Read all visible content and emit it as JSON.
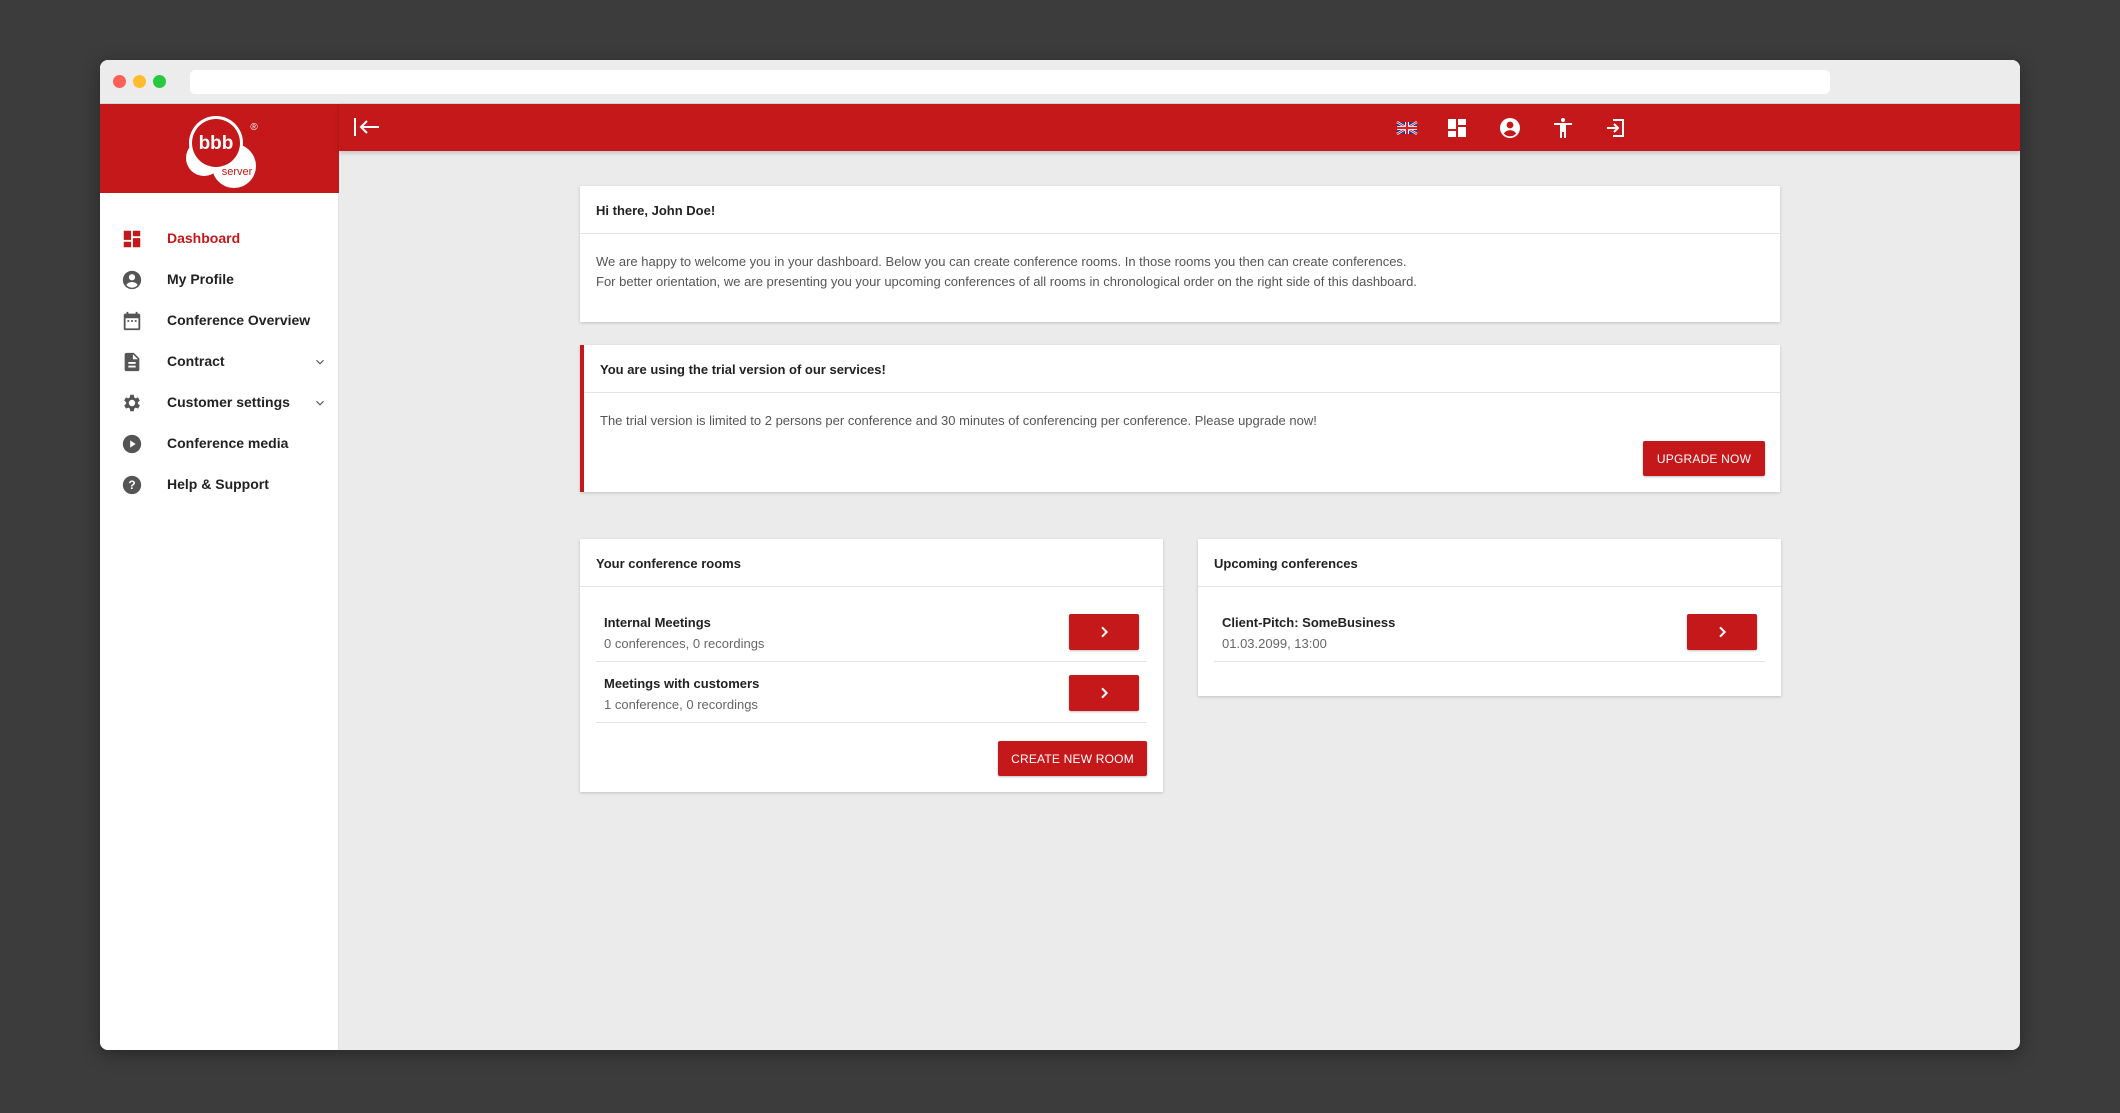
{
  "logo": {
    "text": "bbb",
    "subtext": "server",
    "registered": "®"
  },
  "sidebar": {
    "items": [
      {
        "label": "Dashboard",
        "icon": "dashboard-icon",
        "active": true
      },
      {
        "label": "My Profile",
        "icon": "account-circle-icon"
      },
      {
        "label": "Conference Overview",
        "icon": "calendar-icon"
      },
      {
        "label": "Contract",
        "icon": "document-icon",
        "expandable": true
      },
      {
        "label": "Customer settings",
        "icon": "gear-icon",
        "expandable": true
      },
      {
        "label": "Conference media",
        "icon": "play-circle-icon"
      },
      {
        "label": "Help & Support",
        "icon": "help-circle-icon"
      }
    ]
  },
  "topbar": {
    "icons": [
      "uk-flag-icon",
      "dashboard-icon",
      "account-circle-icon",
      "accessibility-icon",
      "logout-icon"
    ]
  },
  "welcome": {
    "title": "Hi there, John Doe!",
    "line1": "We are happy to welcome you in your dashboard. Below you can create conference rooms. In those rooms you then can create conferences.",
    "line2": "For better orientation, we are presenting you your upcoming conferences of all rooms in chronological order on the right side of this dashboard."
  },
  "trial": {
    "title": "You are using the trial version of our services!",
    "text": "The trial version is limited to 2 persons per conference and 30 minutes of conferencing per conference. Please upgrade now!",
    "button": "UPGRADE NOW"
  },
  "rooms": {
    "title": "Your conference rooms",
    "items": [
      {
        "name": "Internal Meetings",
        "meta": "0 conferences, 0 recordings"
      },
      {
        "name": "Meetings with customers",
        "meta": "1 conference, 0 recordings"
      }
    ],
    "create_button": "CREATE NEW ROOM"
  },
  "upcoming": {
    "title": "Upcoming conferences",
    "items": [
      {
        "name": "Client-Pitch: SomeBusiness",
        "meta": "01.03.2099, 13:00"
      }
    ]
  },
  "colors": {
    "brand": "#c4181a",
    "background": "#ebebeb"
  }
}
